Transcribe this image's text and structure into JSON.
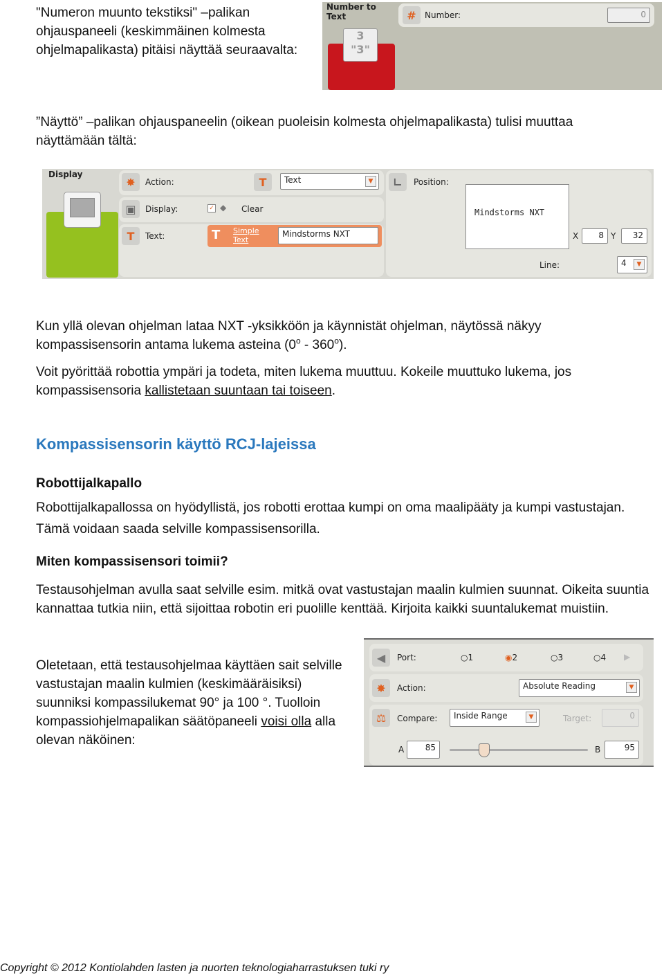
{
  "para1": "\"Numeron muunto tekstiksi\" –palikan ohjauspaneeli (keskimmäinen kolmesta ohjelmapalikasta) pitäisi näyttää seuraavalta:",
  "panel_number_to_text": {
    "title": "Number to Text",
    "number_label": "Number:",
    "number_value": "0",
    "block_color": "#c8161d"
  },
  "para2": "”Näyttö” –palikan ohjauspaneelin (oikean puoleisin kolmesta ohjelmapalikasta) tulisi muuttaa näyttämään tältä:",
  "panel_display": {
    "title": "Display",
    "action_label": "Action:",
    "action_value": "Text",
    "display_label": "Display:",
    "clear_label": "Clear",
    "clear_checked": true,
    "text_label": "Text:",
    "simple_text_label": "Simple Text",
    "text_value": "Mindstorms NXT",
    "position_label": "Position:",
    "preview_text": "Mindstorms NXT",
    "x_label": "X",
    "x_value": "8",
    "y_label": "Y",
    "y_value": "32",
    "line_label": "Line:",
    "line_value": "4",
    "block_color": "#95c11f"
  },
  "para3": {
    "text": "Kun yllä olevan ohjelman lataa NXT -yksikköön ja käynnistät ohjelman, näytössä näkyy kompassisensorin antama lukema asteina (0",
    "sup": "o",
    "mid": " - 360",
    "sup2": "o",
    "end": ")."
  },
  "para4": {
    "text": "Voit pyörittää robottia ympäri ja todeta, miten lukema muuttuu. Kokeile muuttuko lukema, jos kompassisensoria ",
    "link": "kallistetaan suuntaan tai toiseen",
    "end": "."
  },
  "heading": "Kompassisensorin käyttö RCJ-lajeissa",
  "sub1": "Robottijalkapallo",
  "para5": "Robottijalkapallossa on hyödyllistä, jos robotti erottaa kumpi on oma maalipääty ja kumpi vastustajan. Tämä voidaan saada selville kompassisensorilla.",
  "sub2": "Miten kompassisensori toimii?",
  "para6": "Testausohjelman avulla saat selville esim. mitkä ovat vastustajan maalin kulmien suunnat. Oikeita suuntia kannattaa tutkia niin, että sijoittaa robotin eri puolille kenttää. Kirjoita kaikki suuntalukemat muistiin.",
  "para7": {
    "text": "Oletetaan, että testausohjelmaa käyttäen sait selville vastustajan maalin kulmien (keskimääräisiksi) suunniksi kompassilukemat 90° ja 100 °. Tuolloin kompassiohjelmapalikan säätöpaneeli ",
    "link": "voisi olla",
    "end": " alla olevan näköinen:"
  },
  "panel_compass": {
    "port_label": "Port:",
    "ports": [
      "1",
      "2",
      "3",
      "4"
    ],
    "port_selected": "2",
    "action_label": "Action:",
    "action_value": "Absolute Reading",
    "compare_label": "Compare:",
    "compare_value": "Inside Range",
    "target_label": "Target:",
    "target_value": "0",
    "a_label": "A",
    "a_value": "85",
    "b_label": "B",
    "b_value": "95"
  },
  "footer": "Copyright © 2012 Kontiolahden lasten ja nuorten teknologiaharrastuksen tuki ry"
}
